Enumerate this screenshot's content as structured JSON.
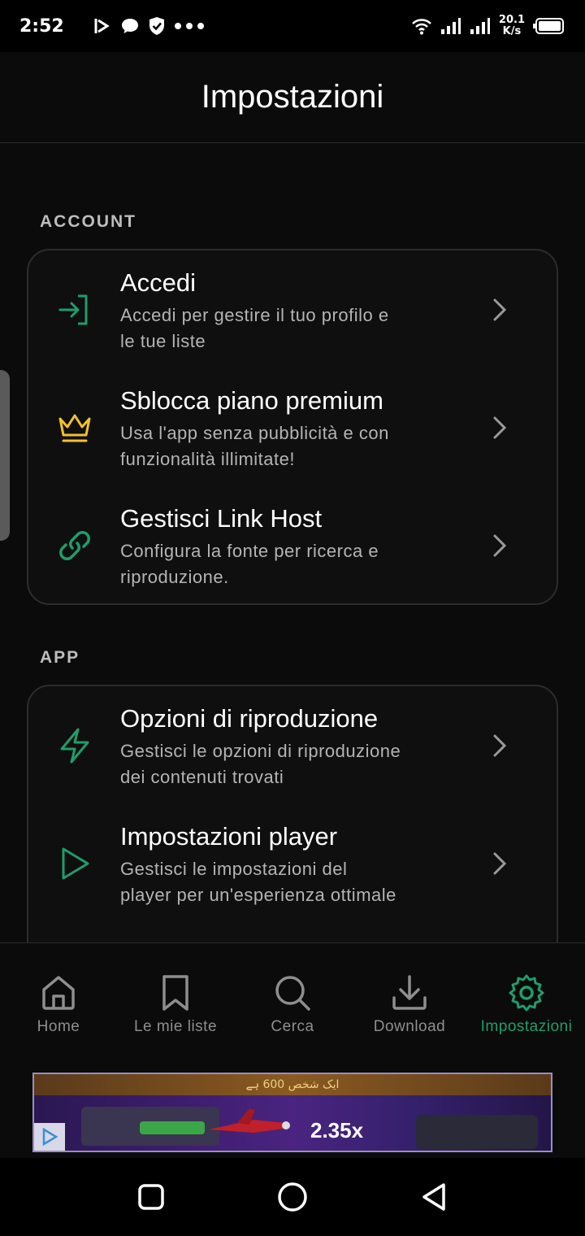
{
  "status_bar": {
    "time": "2:52",
    "net_speed_value": "20.1",
    "net_speed_unit": "K/s"
  },
  "header": {
    "title": "Impostazioni"
  },
  "sections": [
    {
      "label": "ACCOUNT",
      "items": [
        {
          "title": "Accedi",
          "desc_line1": "Accedi per gestire il tuo profilo e",
          "desc_line2": "le tue liste",
          "icon": "login-icon"
        },
        {
          "title": "Sblocca piano premium",
          "desc_line1": "Usa l'app senza pubblicità e con",
          "desc_line2": "funzionalità illimitate!",
          "icon": "crown-icon"
        },
        {
          "title": "Gestisci Link Host",
          "desc_line1": "Configura la fonte per ricerca e",
          "desc_line2": "riproduzione.",
          "icon": "link-icon"
        }
      ]
    },
    {
      "label": "APP",
      "items": [
        {
          "title": "Opzioni di riproduzione",
          "desc_line1": "Gestisci le opzioni di riproduzione",
          "desc_line2": "dei contenuti trovati",
          "icon": "lightning-icon"
        },
        {
          "title": "Impostazioni player",
          "desc_line1": "Gestisci le impostazioni del",
          "desc_line2": "player per un'esperienza ottimale",
          "icon": "play-icon"
        }
      ]
    }
  ],
  "bottom_nav": [
    {
      "label": "Home",
      "icon": "home-icon",
      "active": false
    },
    {
      "label": "Le mie liste",
      "icon": "bookmark-icon",
      "active": false
    },
    {
      "label": "Cerca",
      "icon": "search-icon",
      "active": false
    },
    {
      "label": "Download",
      "icon": "download-icon",
      "active": false
    },
    {
      "label": "Impostazioni",
      "icon": "gear-icon",
      "active": true
    }
  ],
  "ad": {
    "top_text": "ایک شخص 600 ہے",
    "multiplier": "2.35x"
  },
  "colors": {
    "accent_green": "#1f9d6b",
    "crown_yellow": "#f2c12e",
    "background": "#0b0b0b"
  }
}
